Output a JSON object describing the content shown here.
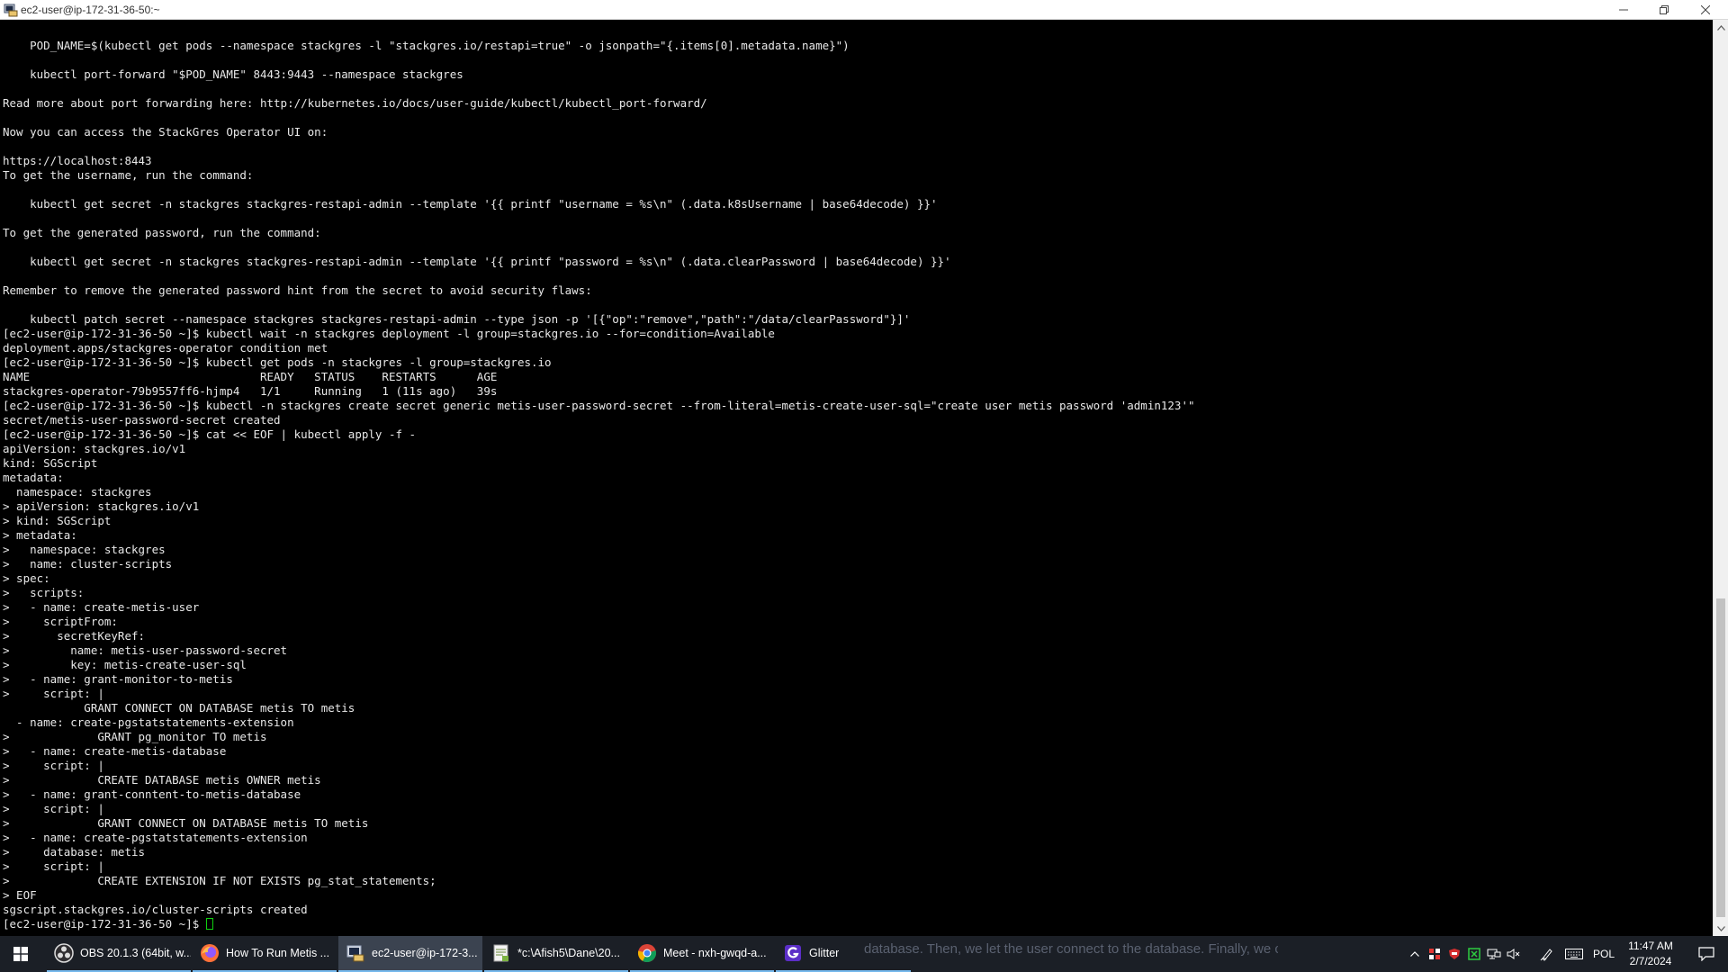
{
  "window": {
    "title": "ec2-user@ip-172-31-36-50:~"
  },
  "terminal": {
    "lines": [
      "    POD_NAME=$(kubectl get pods --namespace stackgres -l \"stackgres.io/restapi=true\" -o jsonpath=\"{.items[0].metadata.name}\")",
      "",
      "    kubectl port-forward \"$POD_NAME\" 8443:9443 --namespace stackgres",
      "",
      "Read more about port forwarding here: http://kubernetes.io/docs/user-guide/kubectl/kubectl_port-forward/",
      "",
      "Now you can access the StackGres Operator UI on:",
      "",
      "https://localhost:8443",
      "To get the username, run the command:",
      "",
      "    kubectl get secret -n stackgres stackgres-restapi-admin --template '{{ printf \"username = %s\\n\" (.data.k8sUsername | base64decode) }}'",
      "",
      "To get the generated password, run the command:",
      "",
      "    kubectl get secret -n stackgres stackgres-restapi-admin --template '{{ printf \"password = %s\\n\" (.data.clearPassword | base64decode) }}'",
      "",
      "Remember to remove the generated password hint from the secret to avoid security flaws:",
      "",
      "    kubectl patch secret --namespace stackgres stackgres-restapi-admin --type json -p '[{\"op\":\"remove\",\"path\":\"/data/clearPassword\"}]'",
      "[ec2-user@ip-172-31-36-50 ~]$ kubectl wait -n stackgres deployment -l group=stackgres.io --for=condition=Available",
      "deployment.apps/stackgres-operator condition met",
      "[ec2-user@ip-172-31-36-50 ~]$ kubectl get pods -n stackgres -l group=stackgres.io",
      "NAME                                  READY   STATUS    RESTARTS      AGE",
      "stackgres-operator-79b9557ff6-hjmp4   1/1     Running   1 (11s ago)   39s",
      "[ec2-user@ip-172-31-36-50 ~]$ kubectl -n stackgres create secret generic metis-user-password-secret --from-literal=metis-create-user-sql=\"create user metis password 'admin123'\"",
      "secret/metis-user-password-secret created",
      "[ec2-user@ip-172-31-36-50 ~]$ cat << EOF | kubectl apply -f -",
      "apiVersion: stackgres.io/v1",
      "kind: SGScript",
      "metadata:",
      "  namespace: stackgres",
      "> apiVersion: stackgres.io/v1",
      "> kind: SGScript",
      "> metadata:",
      ">   namespace: stackgres",
      ">   name: cluster-scripts",
      "> spec:",
      ">   scripts:",
      ">   - name: create-metis-user",
      ">     scriptFrom:",
      ">       secretKeyRef:",
      ">         name: metis-user-password-secret",
      ">         key: metis-create-user-sql",
      ">   - name: grant-monitor-to-metis",
      ">     script: |",
      "            GRANT CONNECT ON DATABASE metis TO metis",
      "  - name: create-pgstatstatements-extension",
      ">             GRANT pg_monitor TO metis",
      ">   - name: create-metis-database",
      ">     script: |",
      ">             CREATE DATABASE metis OWNER metis",
      ">   - name: grant-conntent-to-metis-database",
      ">     script: |",
      ">             GRANT CONNECT ON DATABASE metis TO metis",
      ">   - name: create-pgstatstatements-extension",
      ">     database: metis",
      ">     script: |",
      ">             CREATE EXTENSION IF NOT EXISTS pg_stat_statements;",
      "> EOF",
      "sgscript.stackgres.io/cluster-scripts created"
    ],
    "prompt": "[ec2-user@ip-172-31-36-50 ~]$ "
  },
  "taskbar": {
    "tasks": [
      {
        "label": "OBS 20.1.3 (64bit, w...",
        "icon": "obs-icon"
      },
      {
        "label": "How To Run Metis ...",
        "icon": "firefox-icon"
      },
      {
        "label": "ec2-user@ip-172-3...",
        "icon": "terminal-icon"
      },
      {
        "label": "*c:\\Afish5\\Dane\\20...",
        "icon": "notepad-icon"
      },
      {
        "label": "Meet - nxh-gwqd-a...",
        "icon": "chrome-icon"
      },
      {
        "label": "Glitter",
        "icon": "glitter-icon"
      }
    ],
    "background_text": "database. Then, we let the user connect to the database. Finally, we create the pg_st",
    "language": "POL",
    "time": "11:47 AM",
    "date": "2/7/2024"
  },
  "colors": {
    "terminal_bg": "#000000",
    "terminal_fg": "#e8e8e8",
    "cursor": "#10d010",
    "taskbar_bg": "#1b1f26",
    "taskbar_accent": "#76b9ed"
  }
}
